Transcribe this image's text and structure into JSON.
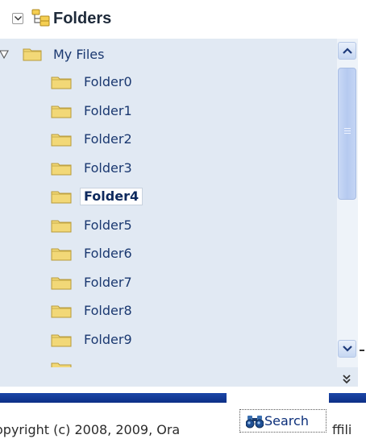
{
  "panel": {
    "title": "Folders",
    "icons": {
      "collapse": "collapse-toggle-icon",
      "header": "folder-tree-icon"
    }
  },
  "tree": {
    "root": {
      "label": "My Files",
      "expanded": true
    },
    "items": [
      {
        "label": "Folder0",
        "selected": false
      },
      {
        "label": "Folder1",
        "selected": false
      },
      {
        "label": "Folder2",
        "selected": false
      },
      {
        "label": "Folder3",
        "selected": false
      },
      {
        "label": "Folder4",
        "selected": true
      },
      {
        "label": "Folder5",
        "selected": false
      },
      {
        "label": "Folder6",
        "selected": false
      },
      {
        "label": "Folder7",
        "selected": false
      },
      {
        "label": "Folder8",
        "selected": false
      },
      {
        "label": "Folder9",
        "selected": false
      }
    ]
  },
  "footer": {
    "copyright_text": "opyright (c) 2008, 2009, Ora",
    "right_text": "ffili",
    "search_button_label": "Search"
  },
  "colors": {
    "tree_background": "#e1e9f3",
    "folder_fill": "#f2d877",
    "bar_blue": "#1c47a8",
    "link_blue": "#1a3870"
  }
}
